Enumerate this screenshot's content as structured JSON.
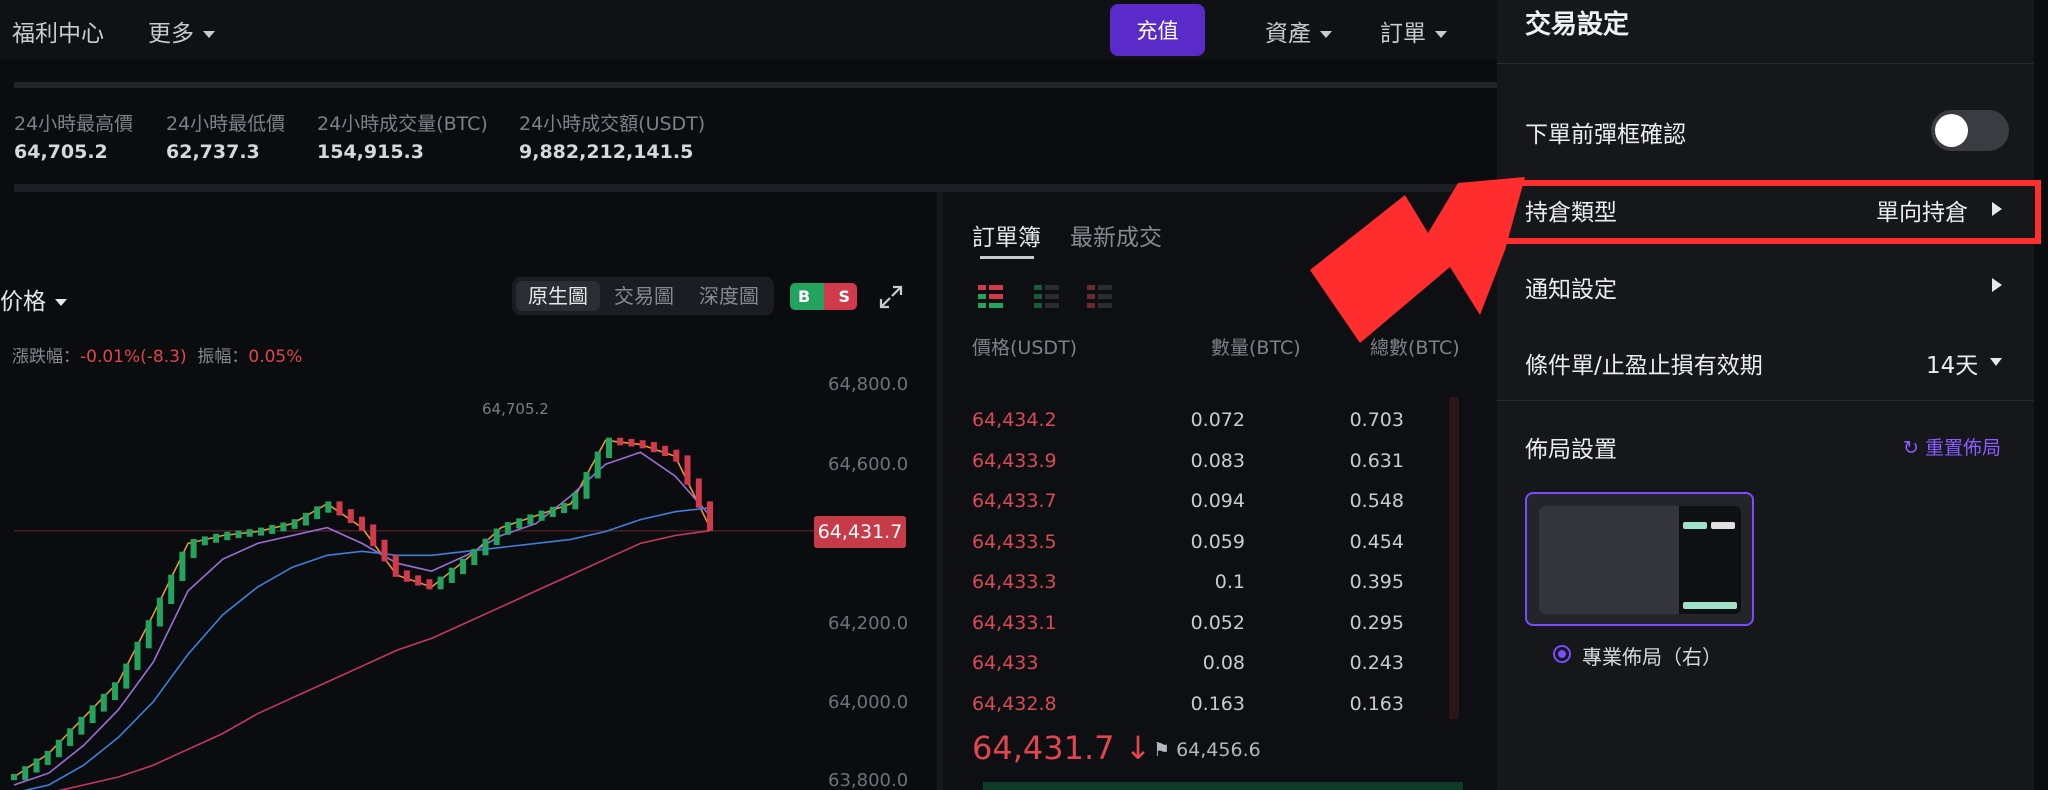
{
  "nav": {
    "welfare_center": "福利中心",
    "more": "更多",
    "deposit": "充值",
    "assets": "資產",
    "orders": "訂單"
  },
  "stats": [
    {
      "label": "24小時最高價",
      "value": "64,705.2"
    },
    {
      "label": "24小時最低價",
      "value": "62,737.3"
    },
    {
      "label": "24小時成交量(BTC)",
      "value": "154,915.3"
    },
    {
      "label": "24小時成交額(USDT)",
      "value": "9,882,212,141.5"
    }
  ],
  "chart": {
    "title": "標記價格",
    "title_visible": "价格",
    "tabs": [
      "原生圖",
      "交易圖",
      "深度圖"
    ],
    "active_tab": "原生圖",
    "bs_buy": "B",
    "bs_sell": "S",
    "change_label": "漲跌幅：",
    "change_value": "-0.01%(-8.3)",
    "amplitude_label": "振幅：",
    "amplitude_value": "0.05%",
    "max_label": "64,705.2",
    "current_price": "64,431.7",
    "y_ticks": [
      "64,800.0",
      "64,600.0",
      "64,200.0",
      "64,000.0",
      "63,800.0"
    ],
    "colors": {
      "up": "#23a35e",
      "down": "#d23a4c"
    }
  },
  "chart_data": {
    "type": "line",
    "y_ticks": [
      "64,800.0",
      "64,600.0",
      "64,200.0",
      "64,000.0",
      "63,800.0"
    ],
    "ylim": [
      63800,
      64800
    ],
    "annotations": [
      "64,705.2",
      "64,431.7"
    ],
    "series": [
      {
        "name": "",
        "values": [
          63810,
          63870,
          63960,
          64050,
          64220,
          64400,
          64420,
          64430,
          64450,
          64500,
          64440,
          64320,
          64290,
          64360,
          64440,
          64470,
          64500,
          64660,
          64650,
          64620,
          64440
        ]
      },
      {
        "name": "",
        "values": [
          63790,
          63820,
          63890,
          63980,
          64100,
          64280,
          64360,
          64400,
          64420,
          64440,
          64400,
          64350,
          64330,
          64370,
          64420,
          64450,
          64520,
          64600,
          64630,
          64570,
          64470
        ]
      },
      {
        "name": "",
        "values": [
          63770,
          63790,
          63840,
          63910,
          64000,
          64120,
          64220,
          64290,
          64340,
          64370,
          64380,
          64370,
          64370,
          64380,
          64390,
          64400,
          64410,
          64430,
          64460,
          64480,
          64490
        ]
      },
      {
        "name": "",
        "values": [
          63760,
          63770,
          63790,
          63810,
          63840,
          63880,
          63920,
          63970,
          64010,
          64050,
          64090,
          64130,
          64160,
          64200,
          64240,
          64280,
          64320,
          64360,
          64400,
          64420,
          64432
        ]
      }
    ]
  },
  "book": {
    "tab_orderbook": "訂單簿",
    "tab_latest": "最新成交",
    "head_price": "價格(USDT)",
    "head_qty": "數量(BTC)",
    "head_total": "總數(BTC)",
    "rows": [
      {
        "price": "64,434.2",
        "qty": "0.072",
        "total": "0.703"
      },
      {
        "price": "64,433.9",
        "qty": "0.083",
        "total": "0.631"
      },
      {
        "price": "64,433.7",
        "qty": "0.094",
        "total": "0.548"
      },
      {
        "price": "64,433.5",
        "qty": "0.059",
        "total": "0.454"
      },
      {
        "price": "64,433.3",
        "qty": "0.1",
        "total": "0.395"
      },
      {
        "price": "64,433.1",
        "qty": "0.052",
        "total": "0.295"
      },
      {
        "price": "64,433",
        "qty": "0.08",
        "total": "0.243"
      },
      {
        "price": "64,432.8",
        "qty": "0.163",
        "total": "0.163"
      }
    ],
    "last_price": "64,431.7",
    "last_arrow": "↓",
    "mark_flag": "⚑",
    "mark_price": "64,456.6"
  },
  "settings": {
    "title": "交易設定",
    "confirm_label": "下單前彈框確認",
    "confirm_on": false,
    "position_type_label": "持倉類型",
    "position_type_value": "單向持倉",
    "notify_label": "通知設定",
    "condition_label": "條件單/止盈止損有效期",
    "condition_value": "14天",
    "layout_label": "佈局設置",
    "reset_layout": "重置佈局",
    "reset_icon": "refresh-icon",
    "layout_option": "專業佈局（右）",
    "accent": "#7b4bff",
    "highlight_color": "#ff2d2d"
  }
}
